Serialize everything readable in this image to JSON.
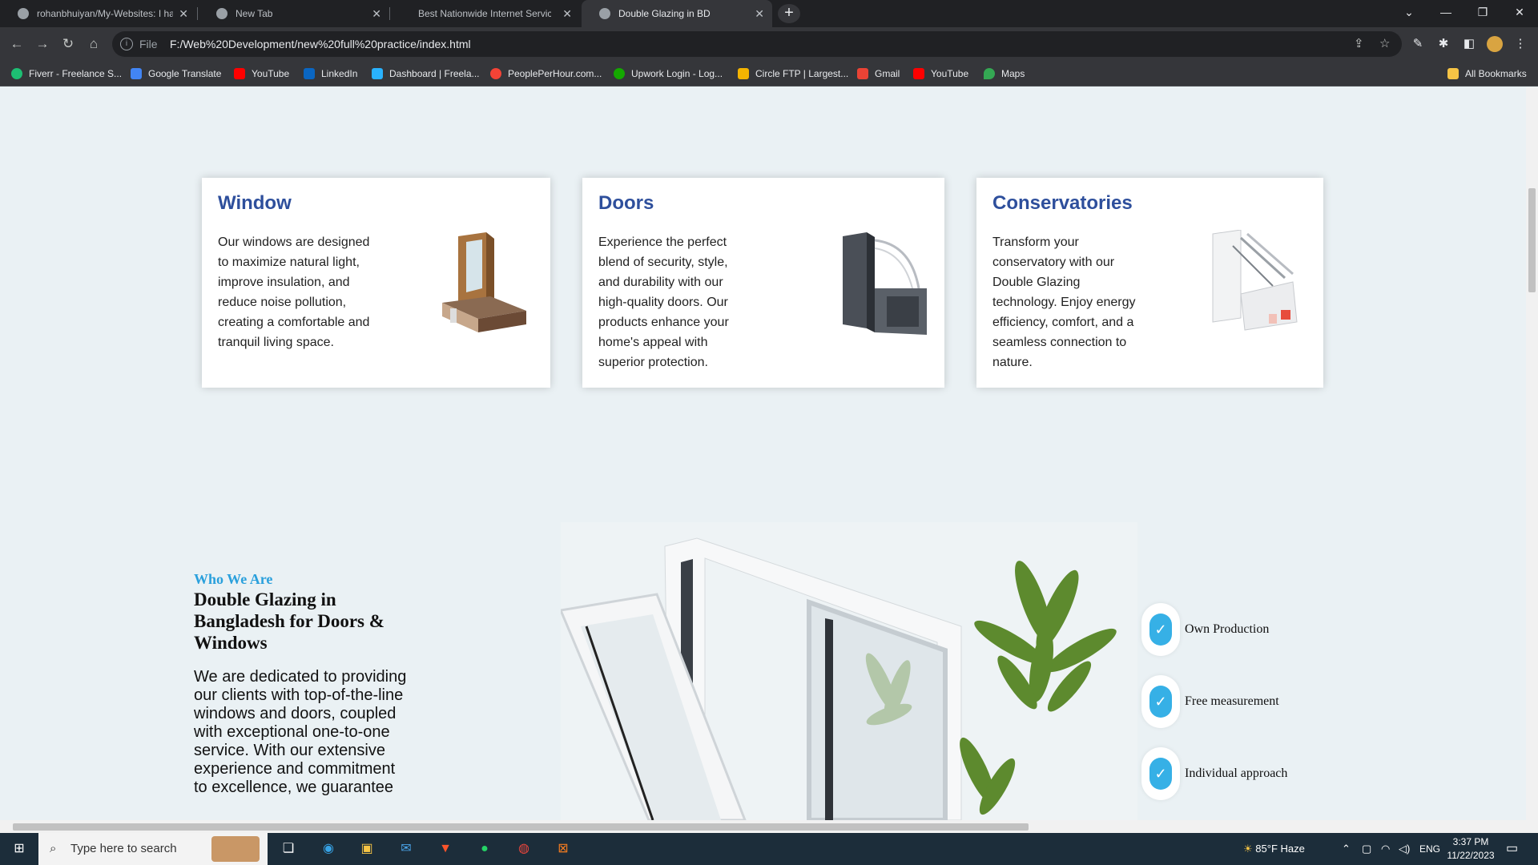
{
  "browser": {
    "tabs": [
      {
        "title": "rohanbhuiyan/My-Websites: I ha",
        "icon": "github-icon"
      },
      {
        "title": "New Tab",
        "icon": "chrome-icon"
      },
      {
        "title": "Best Nationwide Internet Service",
        "icon": "globe-icon"
      },
      {
        "title": "Double Glazing in BD",
        "icon": "globe-icon"
      }
    ],
    "omnibox": {
      "scheme_label": "File",
      "url": "F:/Web%20Development/new%20full%20practice/index.html"
    },
    "bookmarks": [
      {
        "label": "Fiverr - Freelance S...",
        "color": "#1dbf73"
      },
      {
        "label": "Google Translate",
        "color": "#4285f4"
      },
      {
        "label": "YouTube",
        "color": "#ff0000"
      },
      {
        "label": "LinkedIn",
        "color": "#0a66c2"
      },
      {
        "label": "Dashboard | Freela...",
        "color": "#29b2fe"
      },
      {
        "label": "PeoplePerHour.com...",
        "color": "#f44336"
      },
      {
        "label": "Upwork Login - Log...",
        "color": "#14a800"
      },
      {
        "label": "Circle FTP | Largest...",
        "color": "#f4b400"
      },
      {
        "label": "Gmail",
        "color": "#ea4335"
      },
      {
        "label": "YouTube",
        "color": "#ff0000"
      },
      {
        "label": "Maps",
        "color": "#34a853"
      }
    ],
    "all_bookmarks": "All Bookmarks"
  },
  "cards": [
    {
      "title": "Window",
      "text": "Our windows are designed to maximize natural light, improve insulation, and reduce noise pollution, creating a comfortable and tranquil living space."
    },
    {
      "title": "Doors",
      "text": "Experience the perfect blend of security, style, and durability with our high-quality doors. Our products enhance your home's appeal with superior protection."
    },
    {
      "title": "Conservatories",
      "text": "Transform your conservatory with our Double Glazing technology. Enjoy energy efficiency, comfort, and a seamless connection to nature."
    }
  ],
  "who": {
    "subtitle": "Who We Are",
    "heading": "Double Glazing in Bangladesh for Doors & Windows",
    "paragraph": "We are dedicated to providing our clients with top-of-the-line windows and doors, coupled with exceptional one-to-one service. With our extensive experience and commitment to excellence, we guarantee"
  },
  "features": [
    "Own Production",
    "Free measurement",
    "Individual approach"
  ],
  "taskbar": {
    "search_placeholder": "Type here to search",
    "weather": "85°F  Haze",
    "lang": "ENG",
    "time": "3:37 PM",
    "date": "11/22/2023"
  },
  "colors": {
    "accent": "#2e4f9c",
    "sub_accent": "#2aa0dc",
    "check": "#36b0e6"
  }
}
